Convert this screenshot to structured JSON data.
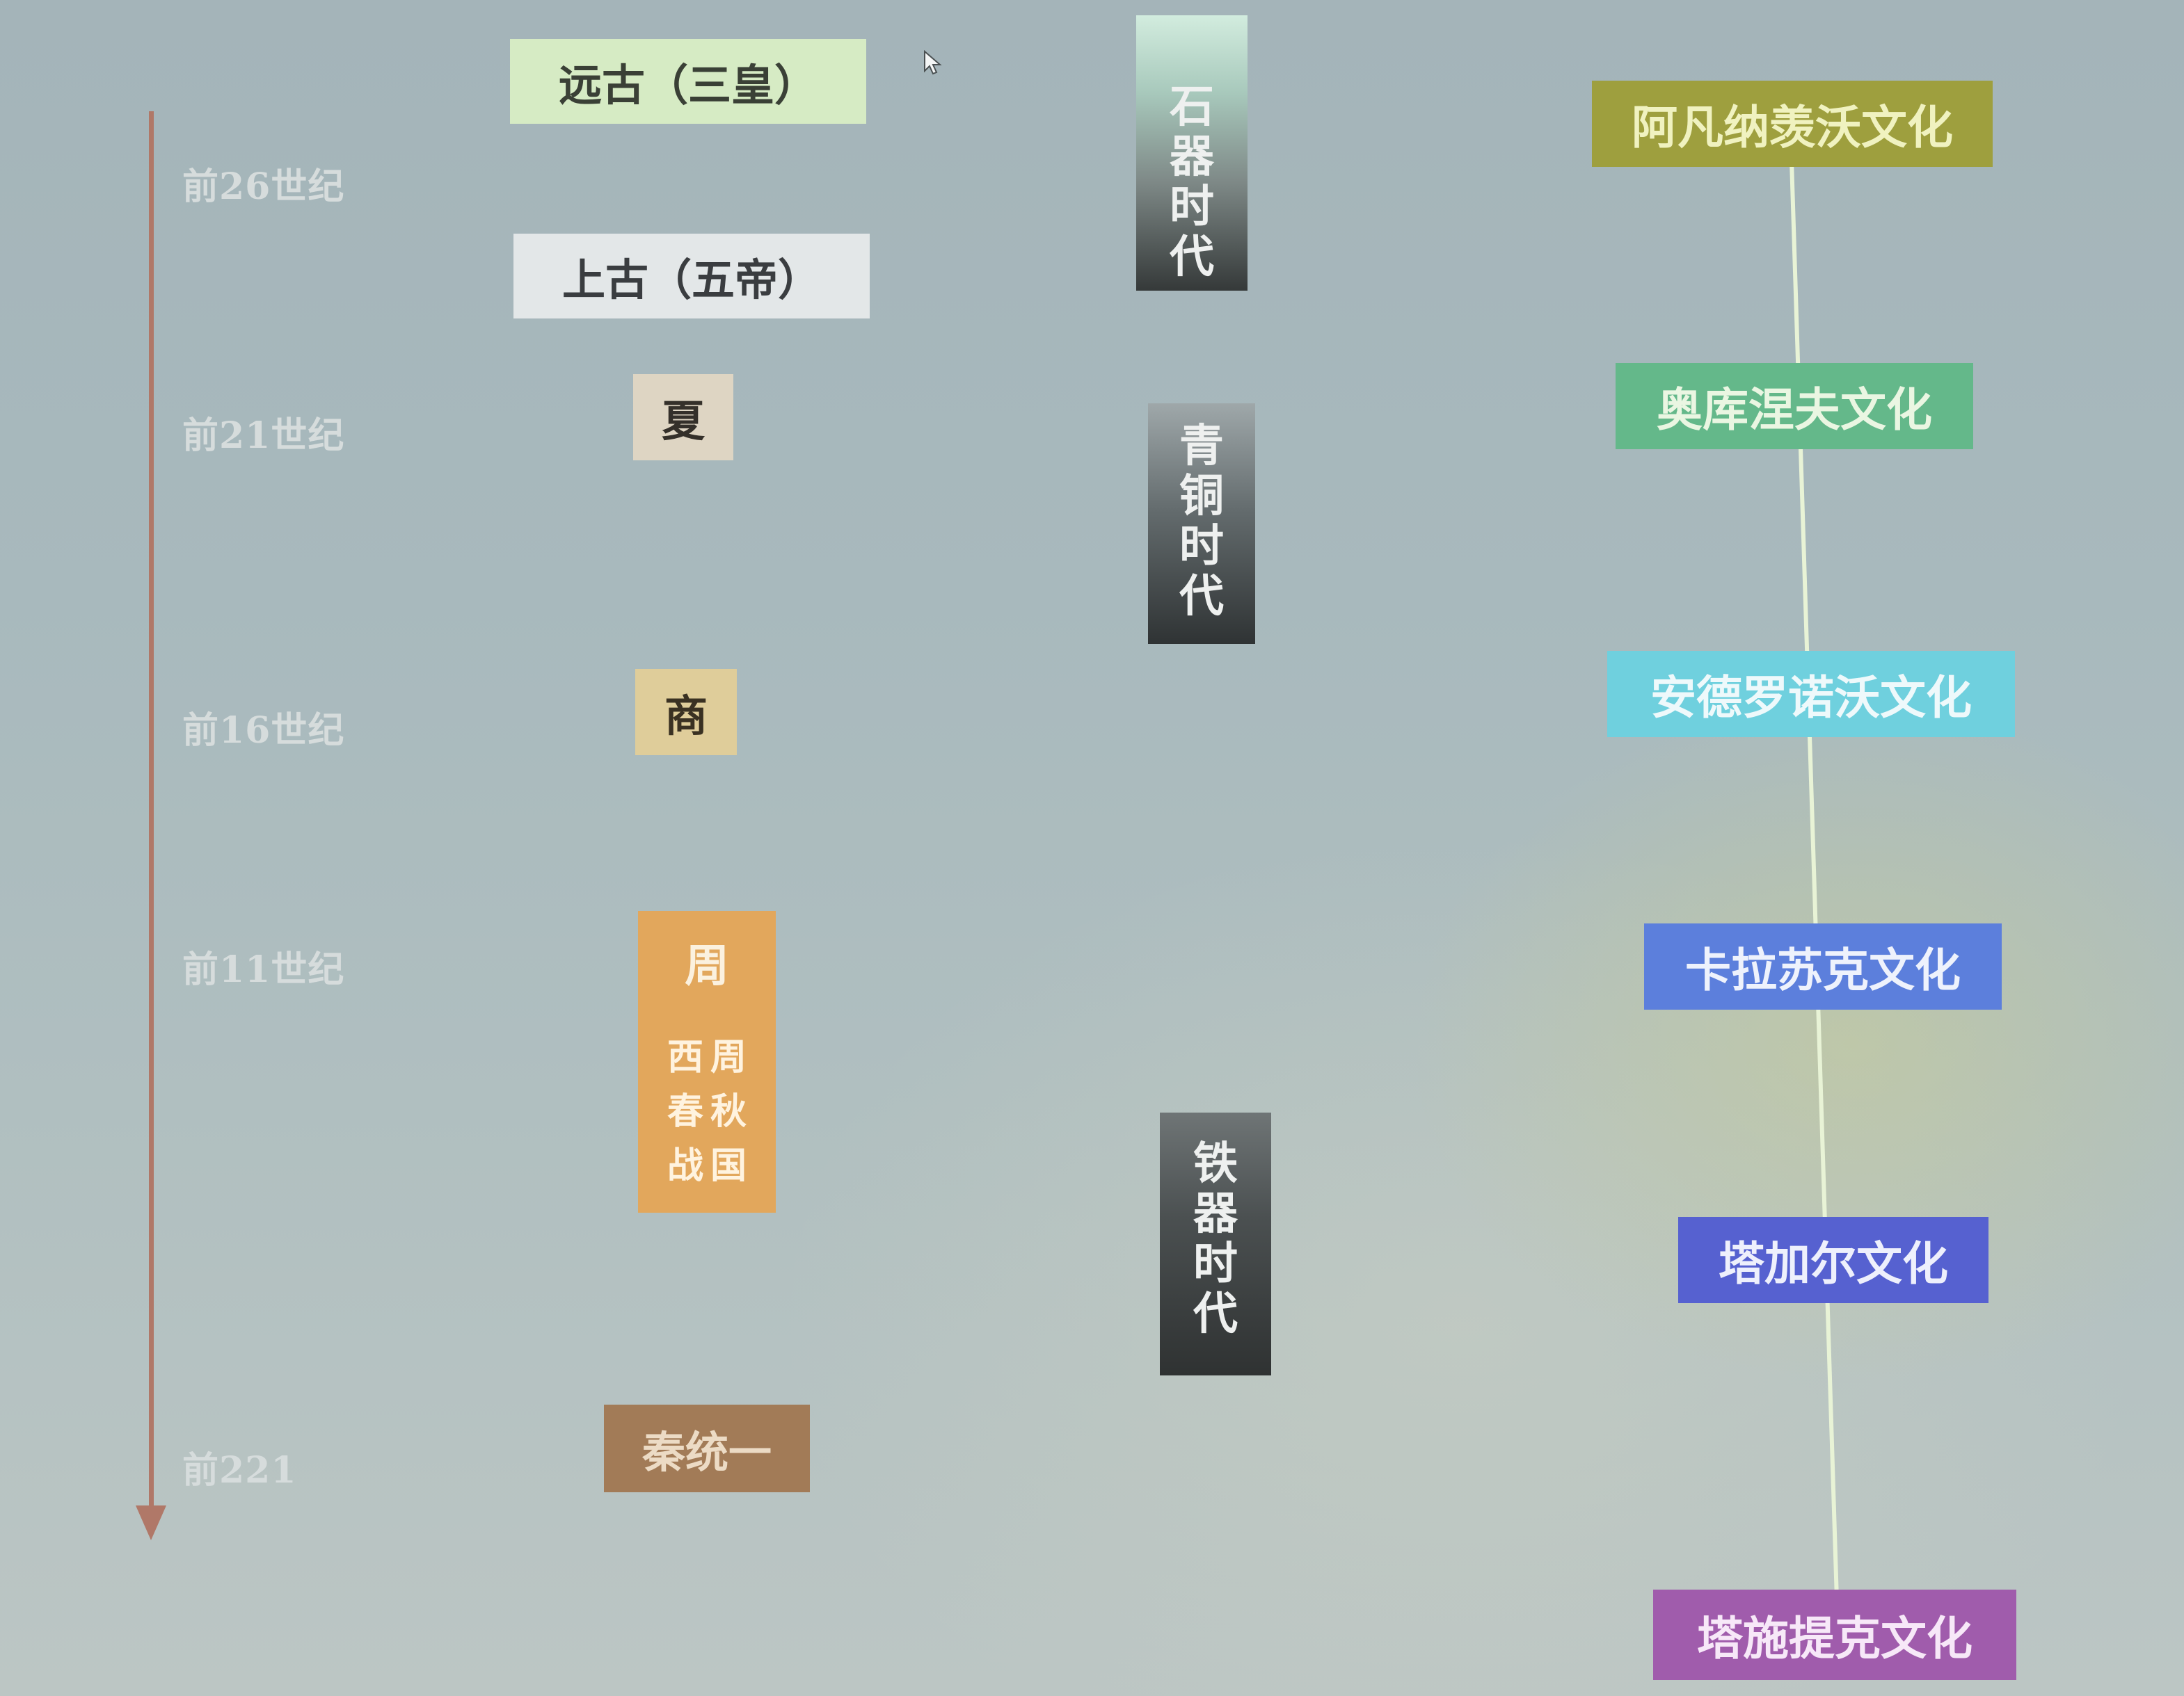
{
  "timeline": {
    "labels": [
      "前26世纪",
      "前21世纪",
      "前16世纪",
      "前11世纪",
      "前221"
    ]
  },
  "dynasties": {
    "yuangu": "远古（三皇）",
    "shanggu": "上古（五帝）",
    "xia": "夏",
    "shang": "商",
    "zhou": {
      "title": "周",
      "sub_col_left": [
        "西",
        "春",
        "战"
      ],
      "sub_col_right": [
        "周",
        "秋",
        "国"
      ]
    },
    "qin": "秦统一"
  },
  "ages": {
    "stone": [
      "石",
      "器",
      "时",
      "代"
    ],
    "bronze": [
      "青",
      "铜",
      "时",
      "代"
    ],
    "iron": [
      "铁",
      "器",
      "时",
      "代"
    ]
  },
  "cultures": [
    "阿凡纳羡沃文化",
    "奥库涅夫文化",
    "安德罗诺沃文化",
    "卡拉苏克文化",
    "塔加尔文化",
    "塔施提克文化"
  ],
  "colors": {
    "axis": "#b07868",
    "culture_line": "#e8f3d6",
    "afanasievo": "#9e9f3e",
    "okunev": "#64b88a",
    "andronovo": "#6fd0de",
    "karasuk": "#5c7fdc",
    "tagar": "#5661d0",
    "tashtyk": "#a05cac",
    "zhou": "#e2a75c",
    "qin": "#a27b57"
  }
}
